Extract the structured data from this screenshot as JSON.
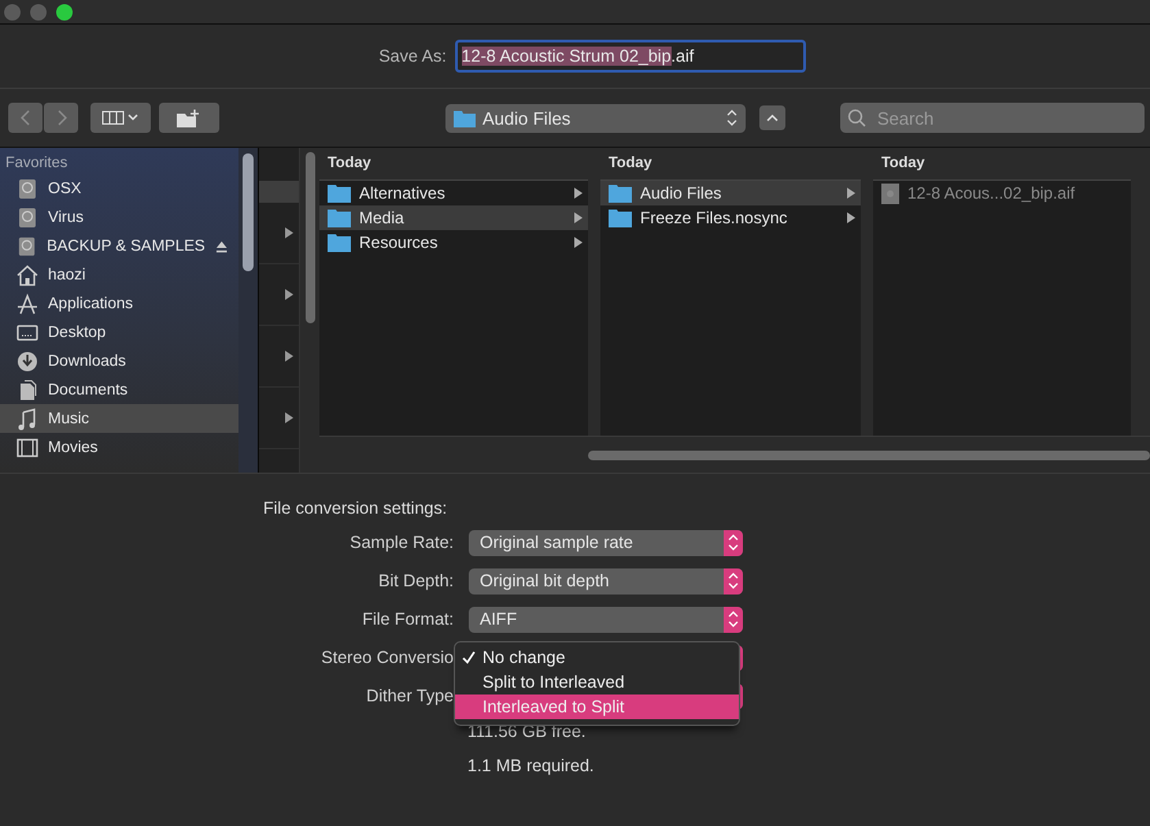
{
  "save_as": {
    "label": "Save As:",
    "selected_text": "12-8 Acoustic Strum 02_bip",
    "rest_text": ".aif"
  },
  "toolbar": {
    "location": "Audio Files",
    "search": {
      "placeholder": "Search"
    }
  },
  "sidebar": {
    "heading": "Favorites",
    "items": [
      {
        "label": "OSX",
        "kind": "disk",
        "selected": false,
        "eject": false
      },
      {
        "label": "Virus",
        "kind": "disk",
        "selected": false,
        "eject": false
      },
      {
        "label": "BACKUP & SAMPLES",
        "kind": "disk",
        "selected": false,
        "eject": true
      },
      {
        "label": "haozi",
        "kind": "home",
        "selected": false,
        "eject": false
      },
      {
        "label": "Applications",
        "kind": "apps",
        "selected": false,
        "eject": false
      },
      {
        "label": "Desktop",
        "kind": "desktop",
        "selected": false,
        "eject": false
      },
      {
        "label": "Downloads",
        "kind": "downloads",
        "selected": false,
        "eject": false
      },
      {
        "label": "Documents",
        "kind": "documents",
        "selected": false,
        "eject": false
      },
      {
        "label": "Music",
        "kind": "music",
        "selected": true,
        "eject": false
      },
      {
        "label": "Movies",
        "kind": "movies",
        "selected": false,
        "eject": false
      }
    ]
  },
  "columns": [
    {
      "header": "Today",
      "items": [
        {
          "label": "Alternatives",
          "kind": "folder",
          "selected": false,
          "disabled": false
        },
        {
          "label": "Media",
          "kind": "folder",
          "selected": true,
          "disabled": false
        },
        {
          "label": "Resources",
          "kind": "folder",
          "selected": false,
          "disabled": false
        }
      ]
    },
    {
      "header": "Today",
      "items": [
        {
          "label": "Audio Files",
          "kind": "folder",
          "selected": true,
          "disabled": false
        },
        {
          "label": "Freeze Files.nosync",
          "kind": "folder",
          "selected": false,
          "disabled": false
        }
      ]
    },
    {
      "header": "Today",
      "items": [
        {
          "label": "12-8 Acous...02_bip.aif",
          "kind": "file",
          "selected": false,
          "disabled": true
        }
      ]
    }
  ],
  "settings": {
    "heading": "File conversion settings:",
    "rows": [
      {
        "label": "Sample Rate:",
        "value": "Original sample rate"
      },
      {
        "label": "Bit Depth:",
        "value": "Original bit depth"
      },
      {
        "label": "File Format:",
        "value": "AIFF"
      },
      {
        "label": "Stereo Conversio"
      },
      {
        "label": "Dither Type"
      }
    ],
    "menu": [
      {
        "label": "No change",
        "checked": true,
        "selected": false
      },
      {
        "label": "Split to Interleaved",
        "checked": false,
        "selected": false
      },
      {
        "label": "Interleaved to Split",
        "checked": false,
        "selected": true
      }
    ],
    "info": [
      "111.56 GB free.",
      "1.1 MB required."
    ]
  }
}
